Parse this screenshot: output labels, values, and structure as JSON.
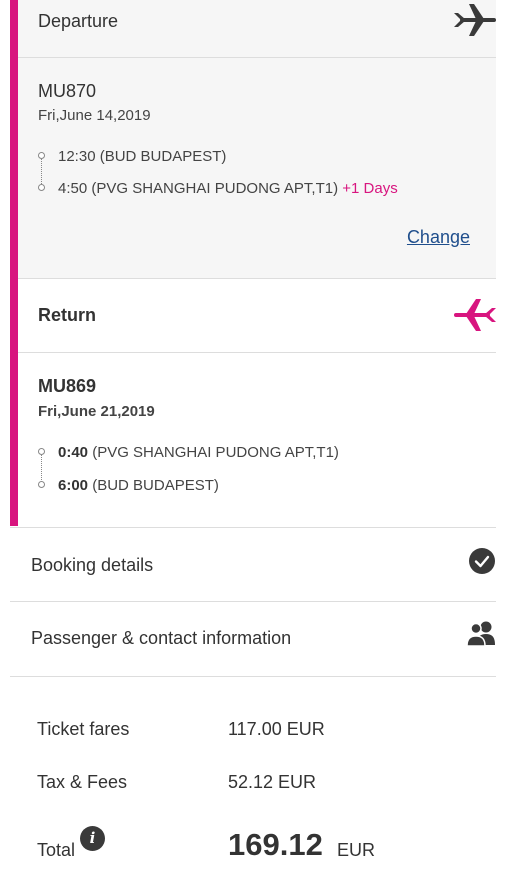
{
  "departure": {
    "title": "Departure",
    "flight_no": "MU870",
    "date": "Fri,June 14,2019",
    "from": {
      "time": "12:30",
      "place": "(BUD BUDAPEST)"
    },
    "to": {
      "time": "4:50",
      "place": "(PVG SHANGHAI PUDONG APT,T1)",
      "extra": "+1 Days"
    },
    "change_label": "Change",
    "icon": "airplane-icon"
  },
  "return": {
    "title": "Return",
    "flight_no": "MU869",
    "date": "Fri,June 21,2019",
    "from": {
      "time": "0:40",
      "place": "(PVG SHANGHAI PUDONG APT,T1)"
    },
    "to": {
      "time": "6:00",
      "place": "(BUD BUDAPEST)"
    },
    "icon": "airplane-icon"
  },
  "booking_details": {
    "label": "Booking details",
    "icon": "check-circle-icon"
  },
  "passenger": {
    "label": "Passenger & contact information",
    "icon": "users-icon"
  },
  "fares": {
    "ticket_label": "Ticket fares",
    "ticket_value": "117.00 EUR",
    "tax_label": "Tax & Fees",
    "tax_value": "52.12 EUR",
    "total_label": "Total",
    "total_amount": "169.12",
    "total_currency": "EUR",
    "info_icon": "i"
  },
  "colors": {
    "accent": "#d8157f",
    "link": "#1f4e8c",
    "panel": "#f6f6f6"
  }
}
